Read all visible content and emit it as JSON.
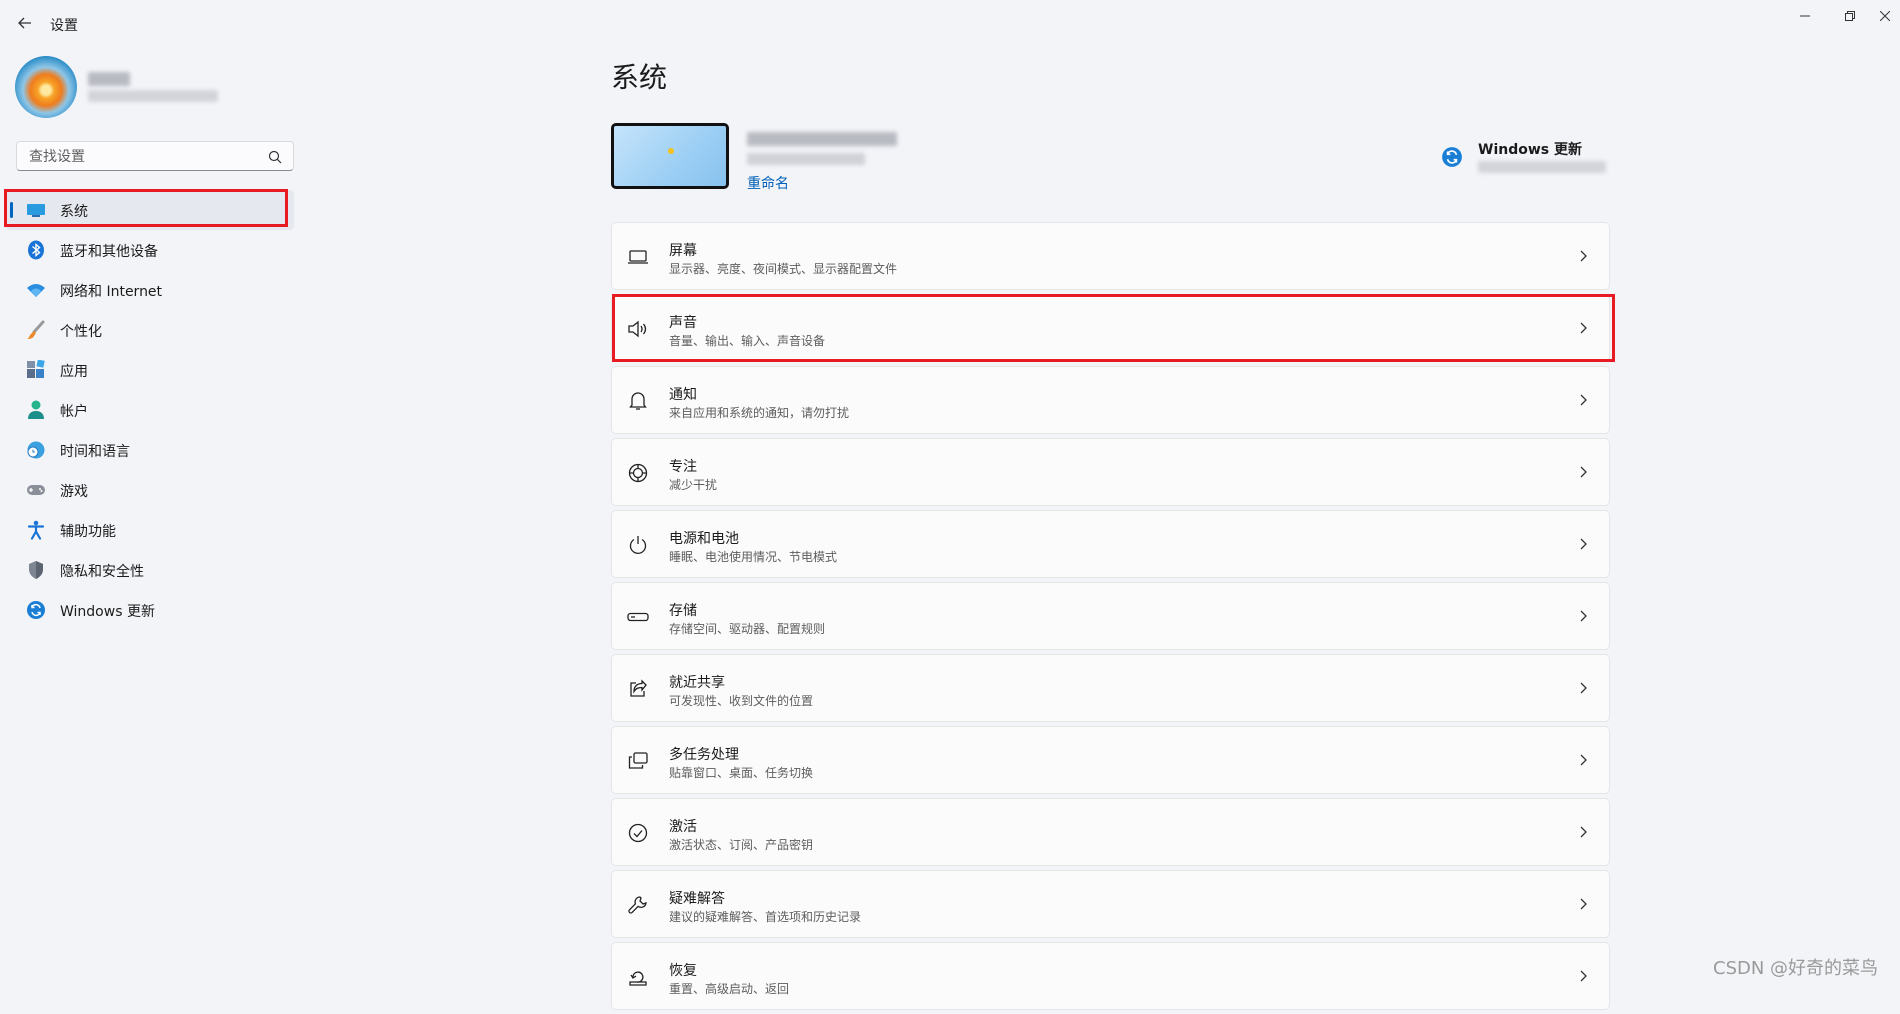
{
  "app": {
    "title": "设置"
  },
  "search": {
    "placeholder": "查找设置"
  },
  "sidebar": {
    "items": [
      {
        "label": "系统",
        "icon": "monitor-icon",
        "active": true
      },
      {
        "label": "蓝牙和其他设备",
        "icon": "bluetooth-icon"
      },
      {
        "label": "网络和 Internet",
        "icon": "wifi-icon"
      },
      {
        "label": "个性化",
        "icon": "brush-icon"
      },
      {
        "label": "应用",
        "icon": "apps-icon"
      },
      {
        "label": "帐户",
        "icon": "account-icon"
      },
      {
        "label": "时间和语言",
        "icon": "globe-clock-icon"
      },
      {
        "label": "游戏",
        "icon": "gamepad-icon"
      },
      {
        "label": "辅助功能",
        "icon": "accessibility-icon"
      },
      {
        "label": "隐私和安全性",
        "icon": "shield-icon"
      },
      {
        "label": "Windows 更新",
        "icon": "update-icon"
      }
    ]
  },
  "main": {
    "title": "系统",
    "device": {
      "rename": "重命名"
    },
    "update": {
      "label": "Windows 更新"
    },
    "cards": [
      {
        "title": "屏幕",
        "subtitle": "显示器、亮度、夜间模式、显示器配置文件",
        "icon": "display-icon"
      },
      {
        "title": "声音",
        "subtitle": "音量、输出、输入、声音设备",
        "icon": "speaker-icon"
      },
      {
        "title": "通知",
        "subtitle": "来自应用和系统的通知，请勿打扰",
        "icon": "bell-icon"
      },
      {
        "title": "专注",
        "subtitle": "减少干扰",
        "icon": "focus-icon"
      },
      {
        "title": "电源和电池",
        "subtitle": "睡眠、电池使用情况、节电模式",
        "icon": "power-icon"
      },
      {
        "title": "存储",
        "subtitle": "存储空间、驱动器、配置规则",
        "icon": "storage-icon"
      },
      {
        "title": "就近共享",
        "subtitle": "可发现性、收到文件的位置",
        "icon": "share-icon"
      },
      {
        "title": "多任务处理",
        "subtitle": "贴靠窗口、桌面、任务切换",
        "icon": "multitask-icon"
      },
      {
        "title": "激活",
        "subtitle": "激活状态、订阅、产品密钥",
        "icon": "check-circle-icon"
      },
      {
        "title": "疑难解答",
        "subtitle": "建议的疑难解答、首选项和历史记录",
        "icon": "wrench-icon"
      },
      {
        "title": "恢复",
        "subtitle": "重置、高级启动、返回",
        "icon": "recovery-icon"
      }
    ]
  },
  "watermark": "CSDN @好奇的菜鸟",
  "colors": {
    "accent": "#0067c0",
    "highlight": "#e81b23",
    "link": "#005fb8"
  }
}
